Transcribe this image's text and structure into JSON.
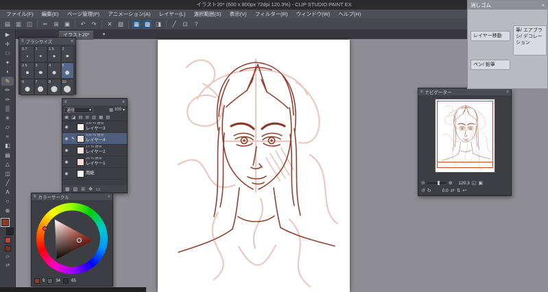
{
  "window": {
    "title": "イラスト20* (600 x 800px 72dpi 120.3%) - CLIP STUDIO PAINT EX",
    "menus": [
      "ファイル(F)",
      "編集(E)",
      "ページ管理(P)",
      "アニメーション(A)",
      "レイヤー(L)",
      "選択範囲(S)",
      "表示(V)",
      "フィルター(R)",
      "ウィンドウ(W)",
      "ヘルプ(H)"
    ]
  },
  "toolbar": {
    "icons": [
      "▤",
      "▥",
      "◫",
      "✂",
      "⊞",
      "▣",
      "↶",
      "↷",
      "✕",
      "▨",
      "▦",
      "▩",
      "◨",
      "╱",
      "⊡",
      "?"
    ]
  },
  "tab": {
    "label": "イラスト20*"
  },
  "toolstrip": {
    "glyphs": [
      "▶",
      "✛",
      "□",
      "✦",
      "◗",
      "✎",
      "✏",
      "✑",
      "▒",
      "✳",
      "▱",
      "≈",
      "◧",
      "▤",
      "△",
      "◫",
      "╱",
      "A",
      "○",
      "⊕"
    ]
  },
  "brush_panel": {
    "title": "ブラシサイズ",
    "sizes": [
      "0.7",
      "1",
      "1.5",
      "2",
      "2.5",
      "3",
      "4",
      "5",
      "6",
      "7",
      "8",
      "10"
    ]
  },
  "layer_panel": {
    "blend_mode": "通常",
    "opacity": "100",
    "rows": [
      {
        "info": "100 % 通常",
        "name": "レイヤー3"
      },
      {
        "info": "100 % 通常",
        "name": "レイヤー4"
      },
      {
        "info": "17 % 通常",
        "name": "レイヤー2"
      },
      {
        "info": "26 % 通常",
        "name": "レイヤー1"
      },
      {
        "info": "",
        "name": "用紙"
      }
    ]
  },
  "color_panel": {
    "title": "カラーサークル",
    "h": "9",
    "s": "34",
    "v": "65"
  },
  "navigator": {
    "title": "ナビゲーター",
    "zoom": "120.3",
    "rotation": "0.0"
  },
  "subtool_panel": {
    "title": "消しゴム",
    "buttons": [
      "レイヤー移動",
      "筆/ エアブラシ/ デコレーション",
      "ペン/ 鉛筆"
    ]
  },
  "icons": {
    "caret_down": "▾",
    "close": "×",
    "burger": "≡",
    "eye": "◉",
    "pencil_edit": "✎",
    "palette_cmds": [
      "▣",
      "◪",
      "▤",
      "⊞",
      "▥",
      "▦",
      "▧"
    ],
    "layer_bar": [
      "▦",
      "▧",
      "⊞",
      "✥",
      "▭"
    ],
    "zoom_out": "⊖",
    "zoom_in": "⊕",
    "fit": "◱",
    "actual_size": "▣",
    "rotate_left": "↺",
    "rotate_right": "↻",
    "flip_h": "⇄",
    "flip_v": "⇅",
    "reset": "↩",
    "slider": "▸",
    "opacity_icon": "▨",
    "transparent": "▱",
    "swap": "⇄"
  },
  "colors": {
    "foreground": "#8a3c2c",
    "background": "#26262b",
    "selection_accent": "#4e5e7c",
    "sketch_dark": "#93402f",
    "sketch_light": "#eac9c2"
  }
}
